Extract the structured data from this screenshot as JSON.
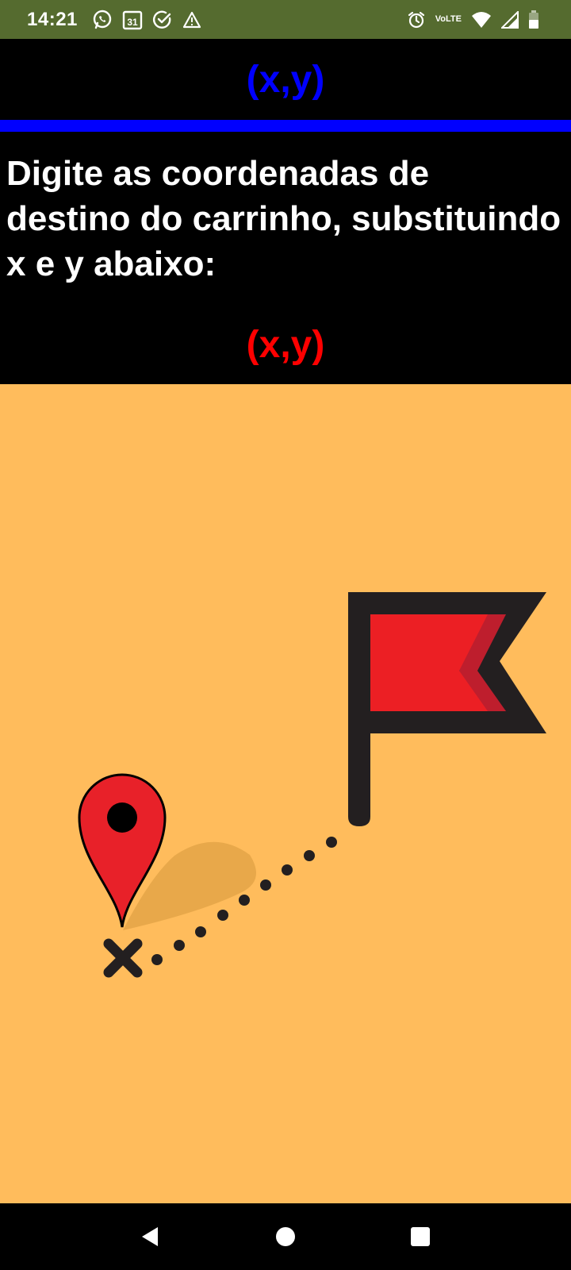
{
  "status_bar": {
    "time": "14:21",
    "left_icons": [
      "whatsapp-icon",
      "calendar-icon",
      "check-circle-icon",
      "warning-icon"
    ],
    "calendar_day": "31",
    "right_icons": [
      "alarm-icon",
      "volte-icon",
      "wifi-icon",
      "signal-icon",
      "battery-icon"
    ],
    "volte_top": "Vo",
    "volte_bottom": "LTE"
  },
  "header": {
    "title": "(x,y)"
  },
  "instructions": {
    "text": "Digite as coordenadas de destino do carrinho, substituindo x e y abaixo:"
  },
  "coordinate_input": {
    "value": "(x,y)"
  },
  "colors": {
    "status_bar": "#556b2f",
    "header_bg": "#000000",
    "accent_blue": "#0000ff",
    "input_red": "#ff0000",
    "map_bg": "#ffbc5c",
    "flag_red": "#ec1f24",
    "pin_red": "#e82129",
    "dark": "#231f20"
  },
  "illustration": {
    "elements": [
      "map-pin-icon",
      "x-mark-icon",
      "dotted-path",
      "destination-flag-icon"
    ]
  },
  "nav_bar": {
    "buttons": [
      "back-icon",
      "home-icon",
      "recents-icon"
    ]
  }
}
